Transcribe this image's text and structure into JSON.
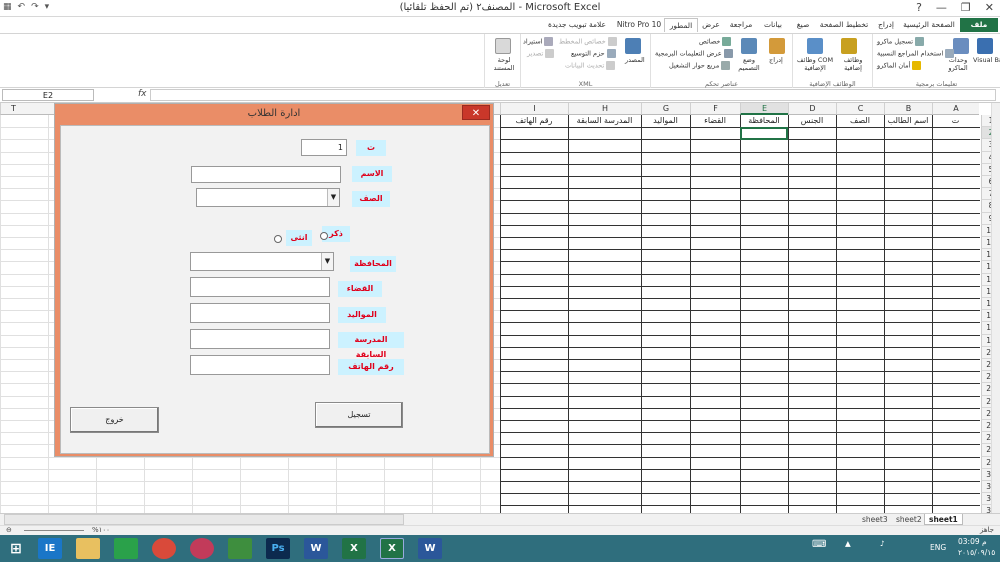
{
  "window": {
    "title": "المصنف٢ (تم الحفظ تلقائيا) - Microsoft Excel",
    "controls": [
      "✕",
      "❐",
      "—",
      "?"
    ]
  },
  "quick_access": [
    "▦",
    "↶",
    "↷",
    "▾"
  ],
  "ribbon_tabs": [
    "ملف",
    "الصفحة الرئيسية",
    "إدراج",
    "تخطيط الصفحة",
    "صيغ",
    "بيانات",
    "مراجعة",
    "عرض",
    "المطور",
    "Nitro Pro 10",
    "علامة تبويب جديدة"
  ],
  "ribbon": {
    "code_group": {
      "label": "تعليمات برمجية",
      "visual_basic": "Visual Basic",
      "macros": "وحدات الماكرو",
      "record_macro": "تسجيل ماكرو",
      "relative_refs": "استخدام المراجع النسبية",
      "macro_security": "أمان الماكرو"
    },
    "addins_group": {
      "label": "الوظائف الإضافية",
      "addins": "وظائف إضافية",
      "com_addins": "وظائف COM الإضافية"
    },
    "controls_group": {
      "label": "عناصر تحكم",
      "insert": "إدراج",
      "design_mode": "وضع التصميم",
      "properties": "خصائص",
      "view_code": "عرض التعليمات البرمجية",
      "run_dialog": "مربع حوار التشغيل"
    },
    "xml_group": {
      "label": "XML",
      "source": "المصدر",
      "map_properties": "خصائص المخطط",
      "expansion_packs": "حزم التوسيع",
      "refresh_data": "تحديث البيانات",
      "import": "استيراد",
      "export": "تصدير"
    },
    "modify_group": {
      "label": "تعديل",
      "document_panel": "لوحة المستند"
    }
  },
  "formula_bar": {
    "name_box": "E2",
    "fx": "fx",
    "value": ""
  },
  "grid": {
    "columns": [
      "A",
      "B",
      "C",
      "D",
      "E",
      "F",
      "G",
      "H",
      "I",
      "T"
    ],
    "rows": [
      "1",
      "2",
      "3",
      "4",
      "5",
      "6",
      "7",
      "8",
      "9",
      "10",
      "11",
      "12",
      "13",
      "14",
      "15",
      "16",
      "17",
      "18",
      "19",
      "20",
      "21",
      "22",
      "23",
      "24",
      "25",
      "26",
      "27",
      "28",
      "29",
      "30",
      "31",
      "32",
      "33"
    ],
    "header_row": [
      "ت",
      "اسم الطالب",
      "الصف",
      "الجنس",
      "المحافظة",
      "القضاء",
      "المواليد",
      "المدرسة السابقة",
      "رقم الهاتف"
    ],
    "selected_cell": "E2"
  },
  "dialog": {
    "title": "ادارة الطلاب",
    "close": "✕",
    "labels": {
      "serial": "ت",
      "name": "الاسم",
      "class": "الصف",
      "male": "ذكر",
      "female": "انثى",
      "governorate": "المحافظة",
      "district": "القضاء",
      "birth": "المواليد",
      "prev_school": "المدرسة السابقة",
      "phone": "رقم الهاتف"
    },
    "serial_value": "1",
    "register_button": "تسجيل",
    "exit_button": "خروج"
  },
  "sheets": [
    "sheet1",
    "sheet2",
    "sheet3"
  ],
  "active_sheet": "sheet1",
  "status": {
    "ready": "جاهز",
    "zoom": "%١٠٠"
  },
  "taskbar": {
    "apps": [
      "IE",
      "Files",
      "Store",
      "Chrome",
      "Opera",
      "Calc",
      "Ps",
      "W",
      "X",
      "X",
      "W"
    ],
    "time": "03:09 م",
    "date": "٢٠١٥/٠٩/١٥",
    "lang": "ENG"
  },
  "colors": {
    "excel_green": "#217346",
    "dialog_frame": "#ea8d67",
    "label_bg": "#ccf2ff",
    "label_text": "#e0001b",
    "taskbar": "#2f6e7d"
  }
}
